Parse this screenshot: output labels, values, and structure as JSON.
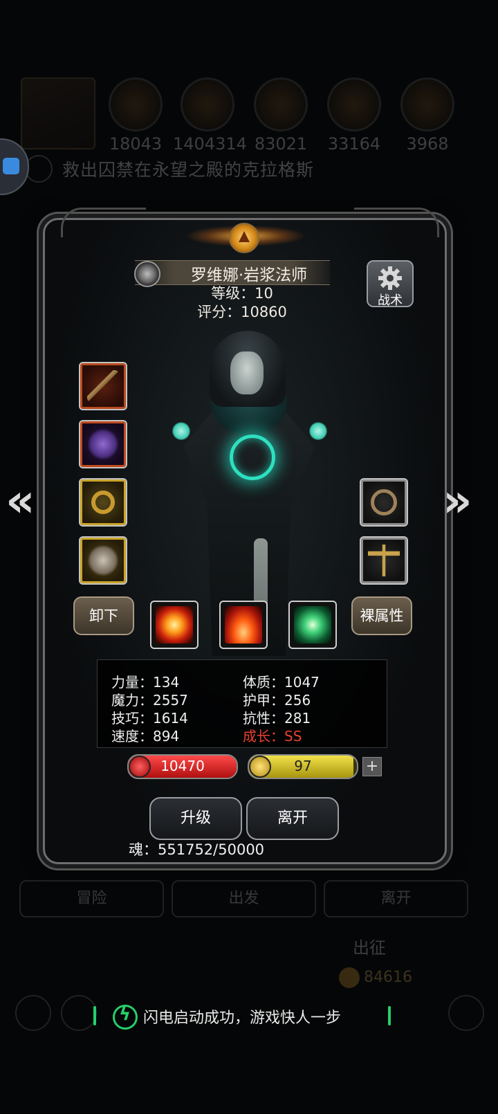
{
  "background": {
    "resources": [
      "18043",
      "1404314",
      "83021",
      "33164",
      "3968"
    ],
    "quest_text": "救出囚禁在永望之殿的克拉格斯",
    "tabs": [
      "冒险",
      "出发",
      "离开"
    ],
    "dispatch_label": "出征",
    "gold_amount": "84616"
  },
  "hero": {
    "name": "罗维娜·岩浆法师",
    "level_text": "等级：10",
    "score_text": "评分：10860",
    "tactics_label": "战术"
  },
  "buttons": {
    "unequip": "卸下",
    "bare_attributes": "裸属性",
    "upgrade": "升级",
    "leave": "离开"
  },
  "stats": {
    "strength": "力量：134",
    "constitution": "体质：1047",
    "magic": "魔力：2557",
    "armor": "护甲：256",
    "skill": "技巧：1614",
    "resistance": "抗性：281",
    "speed": "速度：894",
    "growth": "成长：SS"
  },
  "bars": {
    "hp": "10470",
    "hp_fill": 1.0,
    "energy": "97",
    "energy_fill": 0.97
  },
  "soul_text": "魂：551752/50000",
  "toast": {
    "text": "闪电启动成功，游戏快人一步"
  },
  "colors": {
    "hp": "#d21c1c",
    "energy": "#d4c21a",
    "growth": "#e8412f",
    "toast_accent": "#25d06a"
  }
}
